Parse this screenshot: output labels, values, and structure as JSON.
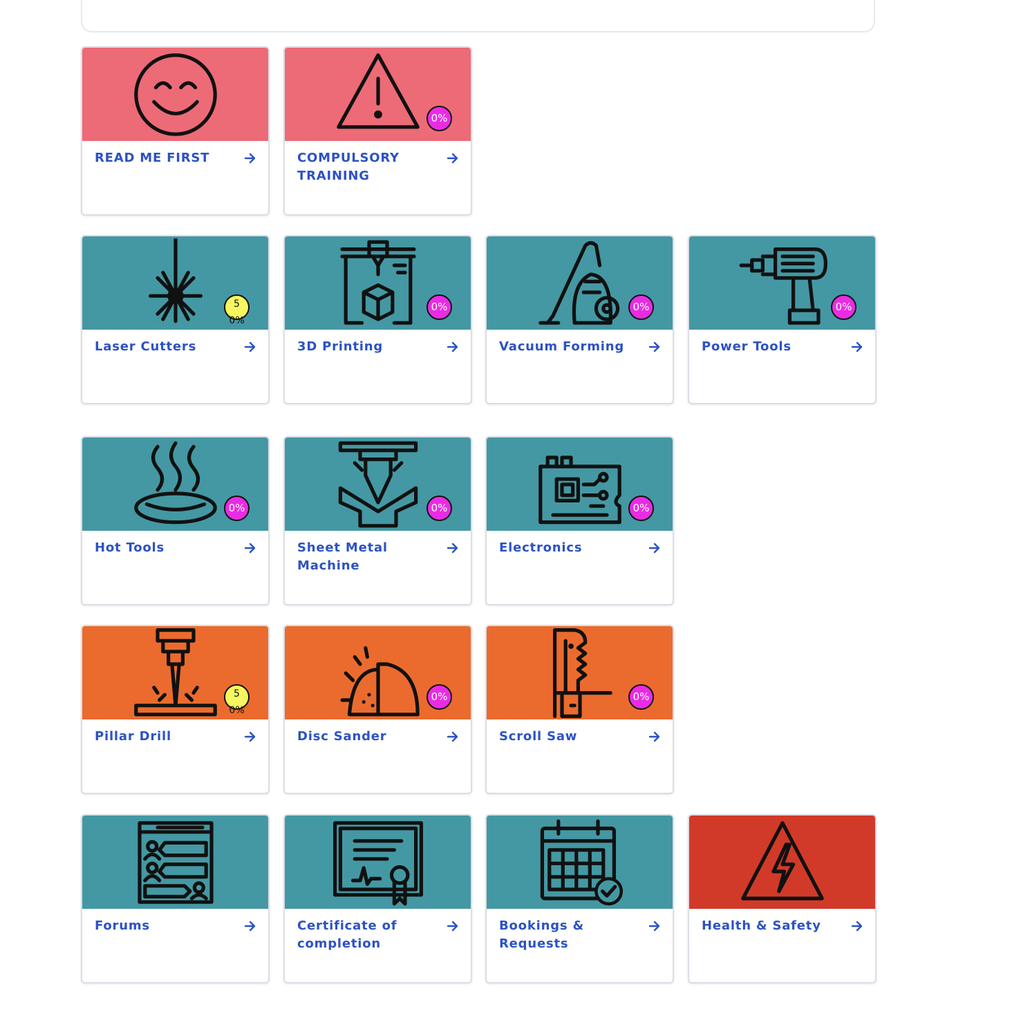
{
  "colors": {
    "pink": "#ec6b76",
    "teal": "#4498a3",
    "orange": "#eb6b2e",
    "red": "#d13a28",
    "link": "#2c52c4",
    "badge_zero": "#e92ce4",
    "badge_half": "#f7f760"
  },
  "tiles": [
    {
      "title": "READ ME FIRST",
      "icon": "smiley-icon",
      "color": "pink",
      "progress": null
    },
    {
      "title": "COMPULSORY TRAINING",
      "icon": "warning-icon",
      "color": "pink",
      "progress": "0%"
    },
    {
      "title": "Laser Cutters",
      "icon": "laser-icon",
      "color": "teal",
      "progress": "50%"
    },
    {
      "title": "3D Printing",
      "icon": "3d-printer-icon",
      "color": "teal",
      "progress": "0%"
    },
    {
      "title": "Vacuum Forming",
      "icon": "vacuum-cleaner-icon",
      "color": "teal",
      "progress": "0%"
    },
    {
      "title": "Power Tools",
      "icon": "drill-icon",
      "color": "teal",
      "progress": "0%"
    },
    {
      "title": "Hot Tools",
      "icon": "hot-steam-icon",
      "color": "teal",
      "progress": "0%"
    },
    {
      "title": "Sheet Metal Machine",
      "icon": "press-brake-icon",
      "color": "teal",
      "progress": "0%"
    },
    {
      "title": "Electronics",
      "icon": "circuit-board-icon",
      "color": "teal",
      "progress": "0%"
    },
    {
      "title": "Pillar Drill",
      "icon": "pillar-drill-icon",
      "color": "orange",
      "progress": "50%"
    },
    {
      "title": "Disc Sander",
      "icon": "disc-sander-icon",
      "color": "orange",
      "progress": "0%"
    },
    {
      "title": "Scroll Saw",
      "icon": "scroll-saw-icon",
      "color": "orange",
      "progress": "0%"
    },
    {
      "title": "Forums",
      "icon": "forum-icon",
      "color": "teal",
      "progress": null
    },
    {
      "title": "Certificate of completion",
      "icon": "certificate-icon",
      "color": "teal",
      "progress": null
    },
    {
      "title": "Bookings & Requests",
      "icon": "calendar-icon",
      "color": "teal",
      "progress": null
    },
    {
      "title": "Health & Safety",
      "icon": "high-voltage-icon",
      "color": "red",
      "progress": null
    }
  ]
}
